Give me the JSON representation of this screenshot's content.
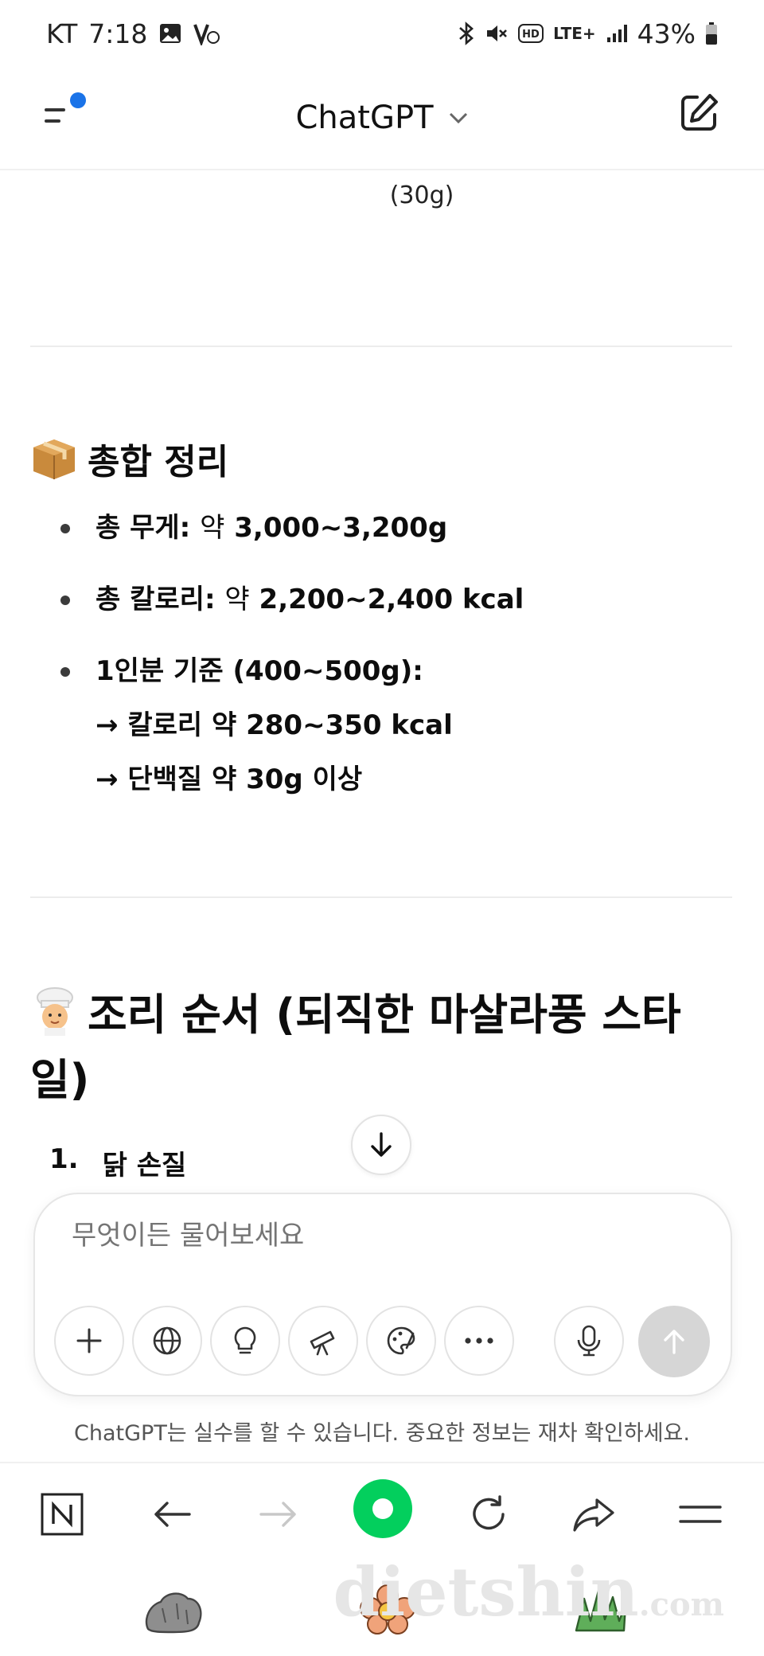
{
  "status_bar": {
    "carrier": "KT",
    "time": "7:18",
    "network": "LTE+",
    "battery": "43%"
  },
  "header": {
    "title": "ChatGPT"
  },
  "content": {
    "previous_text": "(30g)",
    "summary_heading": "총합 정리",
    "summary_items": [
      {
        "label": "총 무게:",
        "mid": "약",
        "value": "3,000~3,200g"
      },
      {
        "label": "총 칼로리:",
        "mid": "약",
        "value": "2,200~2,400 kcal"
      },
      {
        "label": "1인분 기준 (400~500g):",
        "line2": "→ 칼로리 약 280~350 kcal",
        "line3": "→ 단백질 약 30g 이상"
      }
    ],
    "cooking_heading": "조리 순서 (되직한 마살라풍 스타일)",
    "steps": [
      {
        "num": "1.",
        "text": "닭 손질"
      }
    ]
  },
  "composer": {
    "placeholder": "무엇이든 물어보세요"
  },
  "disclaimer": "ChatGPT는 실수를 할 수 있습니다. 중요한 정보는 재차 확인하세요.",
  "watermark": {
    "main": "dietshin",
    "suffix": ".com"
  },
  "colors": {
    "accent_dot": "#1a73e8",
    "home_green": "#03cf5d",
    "send_disabled": "#d6d6d6"
  },
  "icons": {
    "menu": "menu-icon",
    "edit": "edit-icon",
    "plus": "plus-icon",
    "globe": "globe-icon",
    "lightbulb": "lightbulb-icon",
    "telescope": "telescope-icon",
    "paint": "paint-icon",
    "more": "more-icon",
    "mic": "mic-icon",
    "send": "arrow-up-icon"
  }
}
